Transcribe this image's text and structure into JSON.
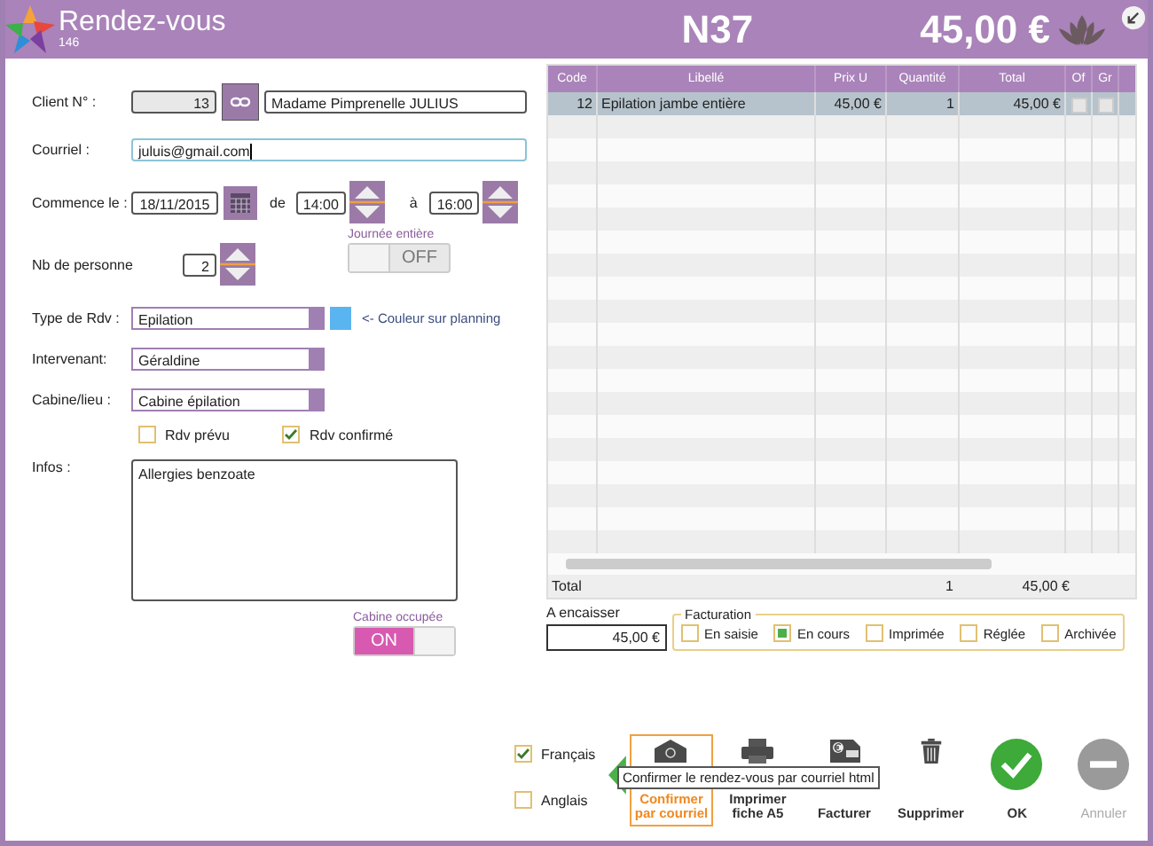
{
  "header": {
    "title": "Rendez-vous",
    "subtitle": "146",
    "code": "N37",
    "amount": "45,00 €"
  },
  "form": {
    "client": {
      "label": "Client N° :",
      "number": "13",
      "name": "Madame Pimprenelle JULIUS"
    },
    "email": {
      "label": "Courriel :",
      "value": "juluis@gmail.com",
      "focused": true
    },
    "start": {
      "label": "Commence le :",
      "date": "18/11/2015",
      "from_label": "de",
      "from": "14:00",
      "to_label": "à",
      "to": "16:00"
    },
    "persons": {
      "label": "Nb de personne",
      "value": "2"
    },
    "all_day": {
      "label": "Journée entière",
      "text": "OFF",
      "on": false
    },
    "type": {
      "label": "Type de Rdv :",
      "value": "Epilation",
      "color": "#5ab4f0",
      "color_hint": "<- Couleur sur planning"
    },
    "staff": {
      "label": "Intervenant:",
      "value": "Géraldine"
    },
    "room": {
      "label": "Cabine/lieu :",
      "value": "Cabine épilation"
    },
    "status_checks": [
      {
        "label": "Rdv prévu",
        "checked": false
      },
      {
        "label": "Rdv confirmé",
        "checked": true
      }
    ],
    "notes": {
      "label": "Infos :",
      "value": "Allergies benzoate"
    },
    "room_busy": {
      "label": "Cabine occupée",
      "text": "ON",
      "on": true
    }
  },
  "table": {
    "columns": [
      "Code",
      "Libellé",
      "Prix U",
      "Quantité",
      "Total",
      "Of",
      "Gr"
    ],
    "rows": [
      {
        "code": "12",
        "label": "Epilation jambe entière",
        "price": "45,00 €",
        "quantity": "1",
        "total": "45,00 €",
        "of": false,
        "gr": false,
        "selected": true
      }
    ],
    "total": {
      "label": "Total",
      "quantity": "1",
      "amount": "45,00 €"
    }
  },
  "payment": {
    "label": "A encaisser",
    "value": "45,00 €"
  },
  "billing": {
    "title": "Facturation",
    "options": [
      {
        "label": "En saisie",
        "checked": false
      },
      {
        "label": "En cours",
        "checked": true
      },
      {
        "label": "Imprimée",
        "checked": false
      },
      {
        "label": "Réglée",
        "checked": false
      },
      {
        "label": "Archivée",
        "checked": false
      }
    ]
  },
  "languages": [
    {
      "label": "Français",
      "checked": true
    },
    {
      "label": "Anglais",
      "checked": false
    }
  ],
  "actions": [
    {
      "kind": "email",
      "label": "Confirmer par courriel",
      "selected": true,
      "disabled": false
    },
    {
      "kind": "print",
      "label": "Imprimer fiche A5",
      "selected": false,
      "disabled": false
    },
    {
      "kind": "invoice",
      "label": "Facturer",
      "selected": false,
      "disabled": false
    },
    {
      "kind": "delete",
      "label": "Supprimer",
      "selected": false,
      "disabled": false
    },
    {
      "kind": "ok",
      "label": "OK",
      "selected": false,
      "disabled": false
    },
    {
      "kind": "cancel",
      "label": "Annuler",
      "selected": false,
      "disabled": true
    }
  ],
  "tooltip": "Confirmer le rendez-vous par courriel html"
}
